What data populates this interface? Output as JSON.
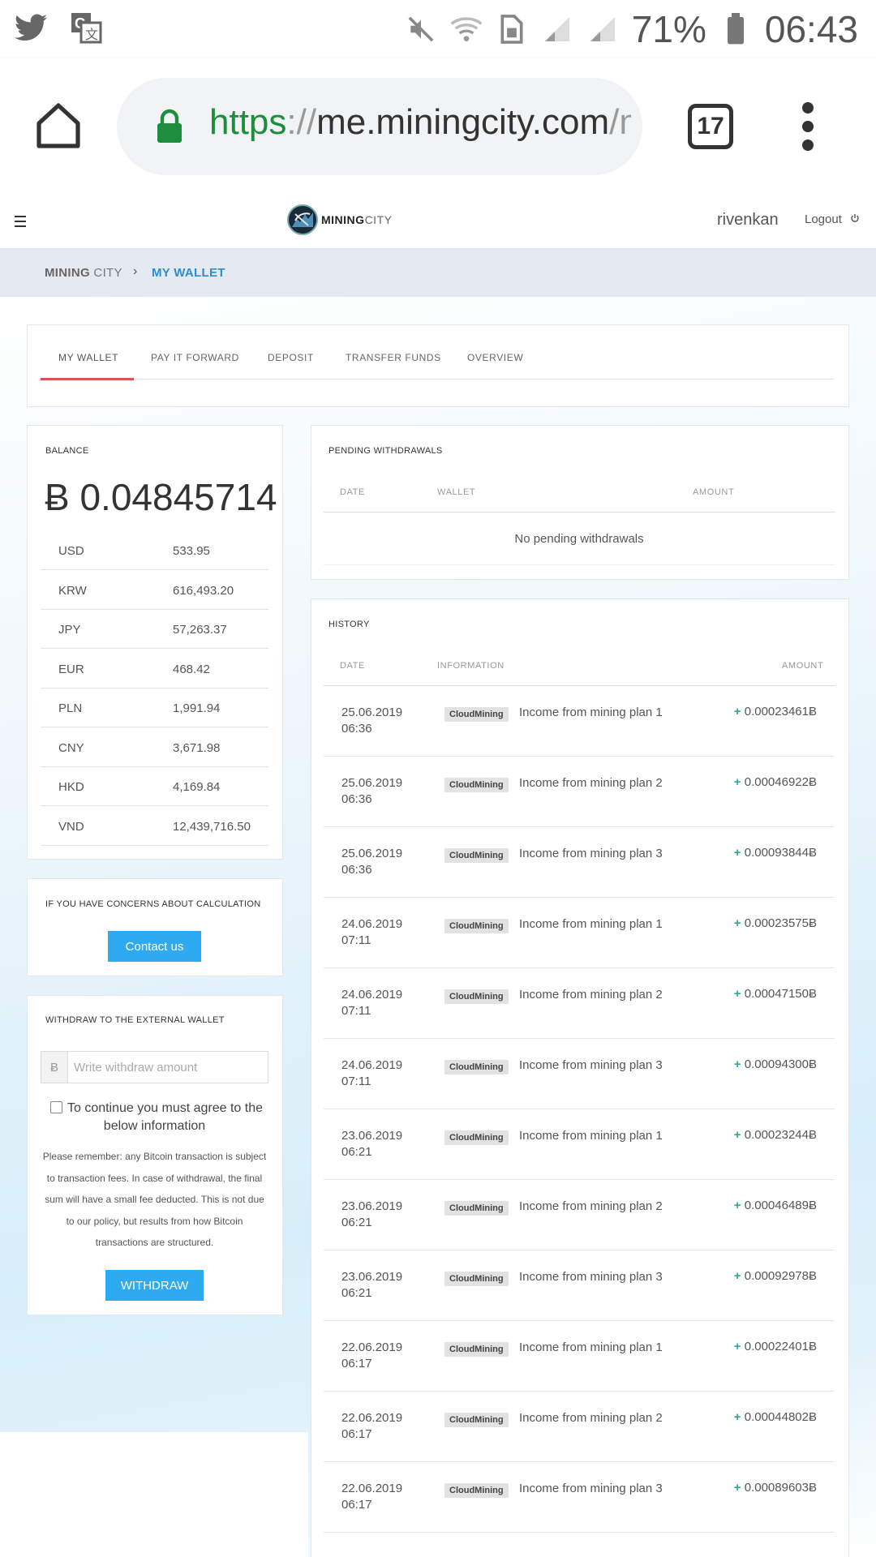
{
  "status_bar": {
    "battery": "71%",
    "time": "06:43",
    "left_icons": [
      "twitter-icon",
      "translate-icon"
    ],
    "right_icons": [
      "mute-icon",
      "wifi-icon",
      "sim-icon",
      "signal-icon",
      "signal-icon",
      "battery-icon"
    ]
  },
  "browser": {
    "url_scheme": "https",
    "url_sep": "://",
    "url_host": "me.miningcity.com",
    "url_path": "/my",
    "tab_count": "17"
  },
  "header": {
    "logo_text_bold": "MINING",
    "logo_text_light": "CITY",
    "username": "rivenkan",
    "logout_label": "Logout"
  },
  "breadcrumb": {
    "root_bold": "MINING",
    "root_light": " CITY",
    "separator": "›",
    "current": "MY WALLET"
  },
  "tabs": [
    "MY WALLET",
    "PAY IT FORWARD",
    "DEPOSIT",
    "TRANSFER FUNDS",
    "OVERVIEW"
  ],
  "balance": {
    "title": "BALANCE",
    "btc_value": "Ƀ 0.04845714",
    "currencies": [
      {
        "code": "USD",
        "value": "533.95"
      },
      {
        "code": "KRW",
        "value": "616,493.20"
      },
      {
        "code": "JPY",
        "value": "57,263.37"
      },
      {
        "code": "EUR",
        "value": "468.42"
      },
      {
        "code": "PLN",
        "value": "1,991.94"
      },
      {
        "code": "CNY",
        "value": "3,671.98"
      },
      {
        "code": "HKD",
        "value": "4,169.84"
      },
      {
        "code": "VND",
        "value": "12,439,716.50"
      }
    ]
  },
  "concern": {
    "title": "IF YOU HAVE CONCERNS ABOUT CALCULATION",
    "button": "Contact us"
  },
  "withdraw": {
    "title": "WITHDRAW TO THE EXTERNAL WALLET",
    "currency_prefix": "Ƀ",
    "placeholder": "Write withdraw amount",
    "agree_text": "To continue you must agree to the below information",
    "note": "Please remember: any Bitcoin transaction is subject to transaction fees. In case of withdrawal, the final sum will have a small fee deducted. This is not due to our policy, but results from how Bitcoin transactions are structured.",
    "button": "WITHDRAW"
  },
  "pending": {
    "title": "PENDING WITHDRAWALS",
    "columns": [
      "DATE",
      "WALLET",
      "AMOUNT"
    ],
    "empty": "No pending withdrawals"
  },
  "history": {
    "title": "HISTORY",
    "columns": [
      "DATE",
      "INFORMATION",
      "AMOUNT"
    ],
    "rows": [
      {
        "date": "25.06.2019",
        "time": "06:36",
        "tag": "CloudMining",
        "info": "Income from mining plan 1",
        "sign": "+",
        "amount": "0.00023461Ƀ"
      },
      {
        "date": "25.06.2019",
        "time": "06:36",
        "tag": "CloudMining",
        "info": "Income from mining plan 2",
        "sign": "+",
        "amount": "0.00046922Ƀ"
      },
      {
        "date": "25.06.2019",
        "time": "06:36",
        "tag": "CloudMining",
        "info": "Income from mining plan 3",
        "sign": "+",
        "amount": "0.00093844Ƀ"
      },
      {
        "date": "24.06.2019",
        "time": "07:11",
        "tag": "CloudMining",
        "info": "Income from mining plan 1",
        "sign": "+",
        "amount": "0.00023575Ƀ"
      },
      {
        "date": "24.06.2019",
        "time": "07:11",
        "tag": "CloudMining",
        "info": "Income from mining plan 2",
        "sign": "+",
        "amount": "0.00047150Ƀ"
      },
      {
        "date": "24.06.2019",
        "time": "07:11",
        "tag": "CloudMining",
        "info": "Income from mining plan 3",
        "sign": "+",
        "amount": "0.00094300Ƀ"
      },
      {
        "date": "23.06.2019",
        "time": "06:21",
        "tag": "CloudMining",
        "info": "Income from mining plan 1",
        "sign": "+",
        "amount": "0.00023244Ƀ"
      },
      {
        "date": "23.06.2019",
        "time": "06:21",
        "tag": "CloudMining",
        "info": "Income from mining plan 2",
        "sign": "+",
        "amount": "0.00046489Ƀ"
      },
      {
        "date": "23.06.2019",
        "time": "06:21",
        "tag": "CloudMining",
        "info": "Income from mining plan 3",
        "sign": "+",
        "amount": "0.00092978Ƀ"
      },
      {
        "date": "22.06.2019",
        "time": "06:17",
        "tag": "CloudMining",
        "info": "Income from mining plan 1",
        "sign": "+",
        "amount": "0.00022401Ƀ"
      },
      {
        "date": "22.06.2019",
        "time": "06:17",
        "tag": "CloudMining",
        "info": "Income from mining plan 2",
        "sign": "+",
        "amount": "0.00044802Ƀ"
      },
      {
        "date": "22.06.2019",
        "time": "06:17",
        "tag": "CloudMining",
        "info": "Income from mining plan 3",
        "sign": "+",
        "amount": "0.00089603Ƀ"
      }
    ]
  },
  "colors": {
    "accent_blue": "#2eaaf0",
    "tab_underline": "#d9534f",
    "plus_green": "#2ba89c",
    "url_green": "#1e8e3e"
  }
}
